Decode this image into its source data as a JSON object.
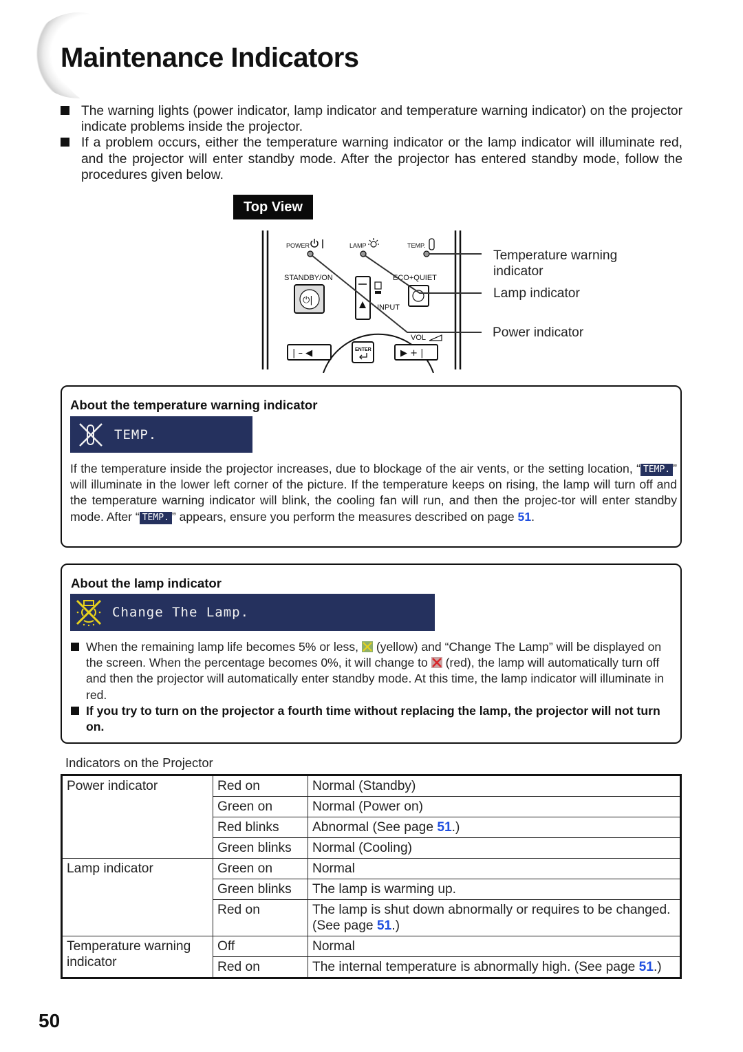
{
  "page": {
    "title": "Maintenance Indicators",
    "page_number": "50"
  },
  "intro": {
    "bullets": [
      "The warning lights (power indicator, lamp indicator and temperature warning indicator) on the projector indicate problems inside the projector.",
      "If a problem occurs, either the temperature warning indicator or the lamp indicator will illuminate red, and the projector will enter standby mode. After the projector has entered standby mode, follow the procedures given below."
    ]
  },
  "diagram": {
    "label": "Top View",
    "panel_labels": {
      "power": "POWER",
      "lamp": "LAMP",
      "temp": "TEMP.",
      "standby": "STANDBY/ON",
      "eco": "ECO+QUIET",
      "input": "INPUT",
      "vol": "VOL",
      "enter": "ENTER"
    },
    "callouts": {
      "temp": "Temperature warning indicator",
      "lamp": "Lamp indicator",
      "power": "Power indicator"
    }
  },
  "temp_box": {
    "heading": "About the temperature warning indicator",
    "osd_text": "TEMP.",
    "chip_text": "TEMP.",
    "para": {
      "part1": "If the temperature inside the projector increases, due to blockage of the air vents, or the setting location, “",
      "part2": "” will illuminate in the lower left corner of the picture. If the temperature keeps on rising, the lamp will turn off and the temperature warning indicator will blink, the cooling fan will run, and then the projec-tor will enter standby mode. After “",
      "part3": "” appears, ensure you perform the measures described on page ",
      "page_ref": "51",
      "end": "."
    }
  },
  "lamp_box": {
    "heading": "About the lamp indicator",
    "osd_text": "Change The Lamp.",
    "bullet1": {
      "part1": "When the remaining lamp life becomes 5% or less, ",
      "part2": " (yellow) and “Change The Lamp” will be displayed on the screen. When the percentage becomes 0%, it will change to ",
      "part3": " (red), the lamp will automatically turn off and then the projector will automatically enter standby mode. At this time, the lamp indicator will illuminate in red."
    },
    "bullet2": "If you try to turn on the projector a fourth time without replacing the lamp, the projector will not turn on.",
    "colors": {
      "osd_bg": "#25315e",
      "yellow": "#e8d21c",
      "red": "#d8262a"
    }
  },
  "table": {
    "caption": "Indicators on the Projector",
    "groups": [
      {
        "indicator": "Power indicator",
        "rows": [
          {
            "state": "Red on",
            "meaning": "Normal (Standby)"
          },
          {
            "state": "Green on",
            "meaning": "Normal (Power on)"
          },
          {
            "state": "Red blinks",
            "meaning": "Abnormal (See page ",
            "ref": "51",
            "tail": ".)"
          },
          {
            "state": "Green blinks",
            "meaning": "Normal (Cooling)"
          }
        ]
      },
      {
        "indicator": "Lamp indicator",
        "rows": [
          {
            "state": "Green on",
            "meaning": "Normal"
          },
          {
            "state": "Green blinks",
            "meaning": "The lamp is warming up."
          },
          {
            "state": "Red on",
            "meaning": "The lamp is shut down abnormally or requires to be changed. (See page ",
            "ref": "51",
            "tail": ".)"
          }
        ]
      },
      {
        "indicator": "Temperature warning indicator",
        "rows": [
          {
            "state": "Off",
            "meaning": "Normal"
          },
          {
            "state": "Red on",
            "meaning": "The internal temperature is abnormally high. (See page ",
            "ref": "51",
            "tail": ".)"
          }
        ]
      }
    ]
  }
}
